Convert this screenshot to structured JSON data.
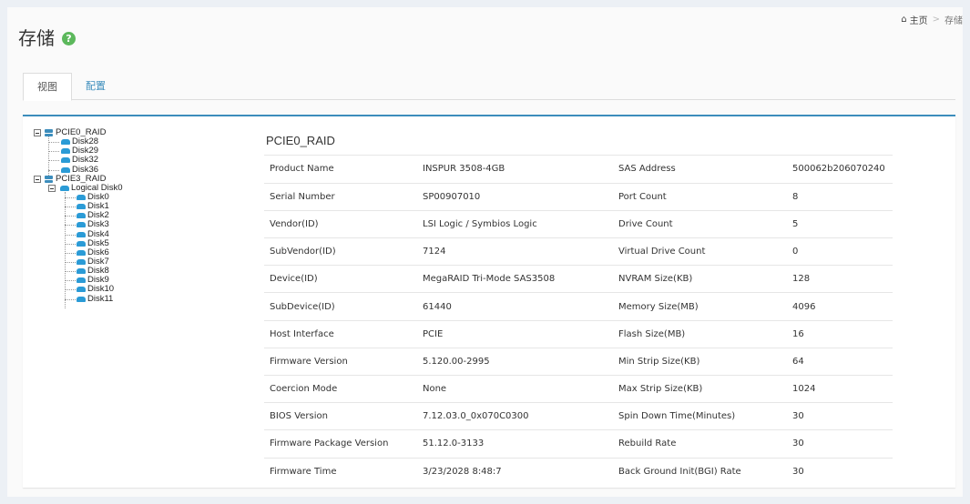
{
  "header": {
    "title": "存储",
    "help_icon": "question-circle-icon",
    "help_glyph": "?"
  },
  "breadcrumb": {
    "home_icon": "home-icon",
    "home_glyph": "⌂",
    "home": "主页",
    "separator": ">",
    "current": "存储"
  },
  "tabs": [
    {
      "label": "视图",
      "active": true
    },
    {
      "label": "配置",
      "active": false
    }
  ],
  "tree": {
    "controllers": [
      {
        "name": "PCIE0_RAID",
        "disks": [
          "Disk28",
          "Disk29",
          "Disk32",
          "Disk36"
        ]
      },
      {
        "name": "PCIE3_RAID",
        "logical": {
          "name": "Logical Disk0",
          "disks": [
            "Disk0",
            "Disk1",
            "Disk2",
            "Disk3",
            "Disk4",
            "Disk5",
            "Disk6",
            "Disk7",
            "Disk8",
            "Disk9",
            "Disk10",
            "Disk11"
          ]
        }
      }
    ]
  },
  "detail": {
    "title": "PCIE0_RAID",
    "rows": [
      [
        "Product Name",
        "INSPUR 3508-4GB",
        "SAS Address",
        "500062b206070240"
      ],
      [
        "Serial Number",
        "SP00907010",
        "Port Count",
        "8"
      ],
      [
        "Vendor(ID)",
        "LSI Logic / Symbios Logic",
        "Drive Count",
        "5"
      ],
      [
        "SubVendor(ID)",
        "7124",
        "Virtual Drive Count",
        "0"
      ],
      [
        "Device(ID)",
        "MegaRAID Tri-Mode SAS3508",
        "NVRAM Size(KB)",
        "128"
      ],
      [
        "SubDevice(ID)",
        "61440",
        "Memory Size(MB)",
        "4096"
      ],
      [
        "Host Interface",
        "PCIE",
        "Flash Size(MB)",
        "16"
      ],
      [
        "Firmware Version",
        "5.120.00-2995",
        "Min Strip Size(KB)",
        "64"
      ],
      [
        "Coercion Mode",
        "None",
        "Max Strip Size(KB)",
        "1024"
      ],
      [
        "BIOS Version",
        "7.12.03.0_0x070C0300",
        "Spin Down Time(Minutes)",
        "30"
      ],
      [
        "Firmware Package Version",
        "51.12.0-3133",
        "Rebuild Rate",
        "30"
      ],
      [
        "Firmware Time",
        "3/23/2028 8:48:7",
        "Back Ground Init(BGI) Rate",
        "30"
      ]
    ]
  },
  "colors": {
    "accent": "#3c8dbc",
    "help_green": "#5cb85c",
    "disk_blue": "#2b9bd6"
  }
}
